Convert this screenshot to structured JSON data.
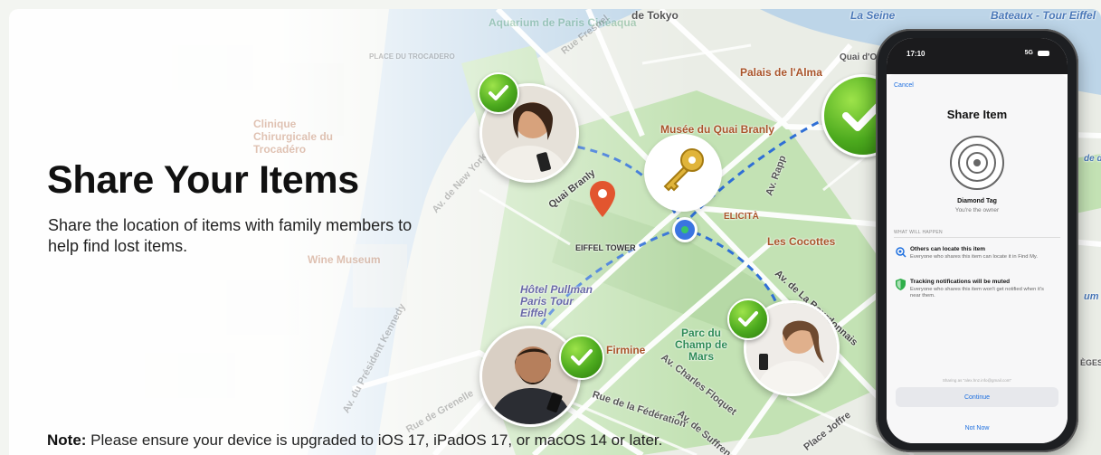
{
  "hero": {
    "title": "Share Your Items",
    "subtitle": "Share the location of items with family members to help find lost items."
  },
  "note": {
    "label": "Note:",
    "text": " Please ensure your device is upgraded to iOS 17, iPadOS 17, or macOS 14 or later."
  },
  "map": {
    "labels": {
      "aquarium": "Aquarium de Paris Cinéaqua",
      "de_tokyo": "de Tokyo",
      "la_seine": "La Seine",
      "bateaux": "Bateaux - Tour Eiffel",
      "trocadero": "PLACE DU TROCADERO",
      "palais": "Palais de l'Alma",
      "quai_orsay": "Quai d'Orsay",
      "musee": "Musée du Quai Branly",
      "elicita": "ELICITÀ",
      "cocottes": "Les Cocottes",
      "eiffel": "EIFFEL TOWER",
      "hotel": "Hôtel Pullman Paris Tour Eiffel",
      "parc": "Parc du Champ de Mars",
      "firmine": "Firmine",
      "bourdonnais": "Av. de La Bourdonnais",
      "quai_branly": "Quai Branly",
      "av_new_york": "Av. de New York",
      "clinique": "Clinique Chirurgicale du Trocadéro",
      "wine": "Wine Museum",
      "president_kennedy": "Av. du Président Kennedy",
      "federation": "Rue de la Fédération",
      "charles": "Av. Charles Floquet",
      "suffren": "Av. de Suffren",
      "joffre": "Place Joffre",
      "rapp": "Av. Rapp",
      "grenelle": "Quai de Grenelle",
      "gremelle": "Rue de Grenelle",
      "place_fresnel": "Rue Fresnel",
      "right_de": "de d",
      "right_um": "um",
      "right_es": "ÈGES"
    }
  },
  "phone": {
    "time": "17:10",
    "signal": "5G",
    "cancel": "Cancel",
    "title": "Share Item",
    "tag_name": "Diamond Tag",
    "tag_owner": "You're the owner",
    "section_header": "WHAT WILL HAPPEN",
    "rows": [
      {
        "title": "Others can locate this item",
        "description": "Everyone who shares this item can locate it in Find My."
      },
      {
        "title": "Tracking notifications will be muted",
        "description": "Everyone who shares this item won't get notified when it's near them."
      }
    ],
    "sharing_as": "Sharing as \"alex.hnz.info@gmail.com\"",
    "continue": "Continue",
    "not_now": "Not Now"
  },
  "colors": {
    "accent_blue": "#1d6fe0",
    "check_green": "#4caa1e",
    "park_green": "#bfe0b0",
    "river_blue": "#aecdeb",
    "pin_red": "#e2552f",
    "dashed_route": "#2f6fd6"
  },
  "icons": {
    "check": "check-icon",
    "key": "key-icon",
    "pin": "map-pin-icon",
    "airtag": "airtag-icon",
    "locate": "magnifier-locate-icon",
    "shield": "shield-icon",
    "location_dot": "location-dot-icon"
  }
}
